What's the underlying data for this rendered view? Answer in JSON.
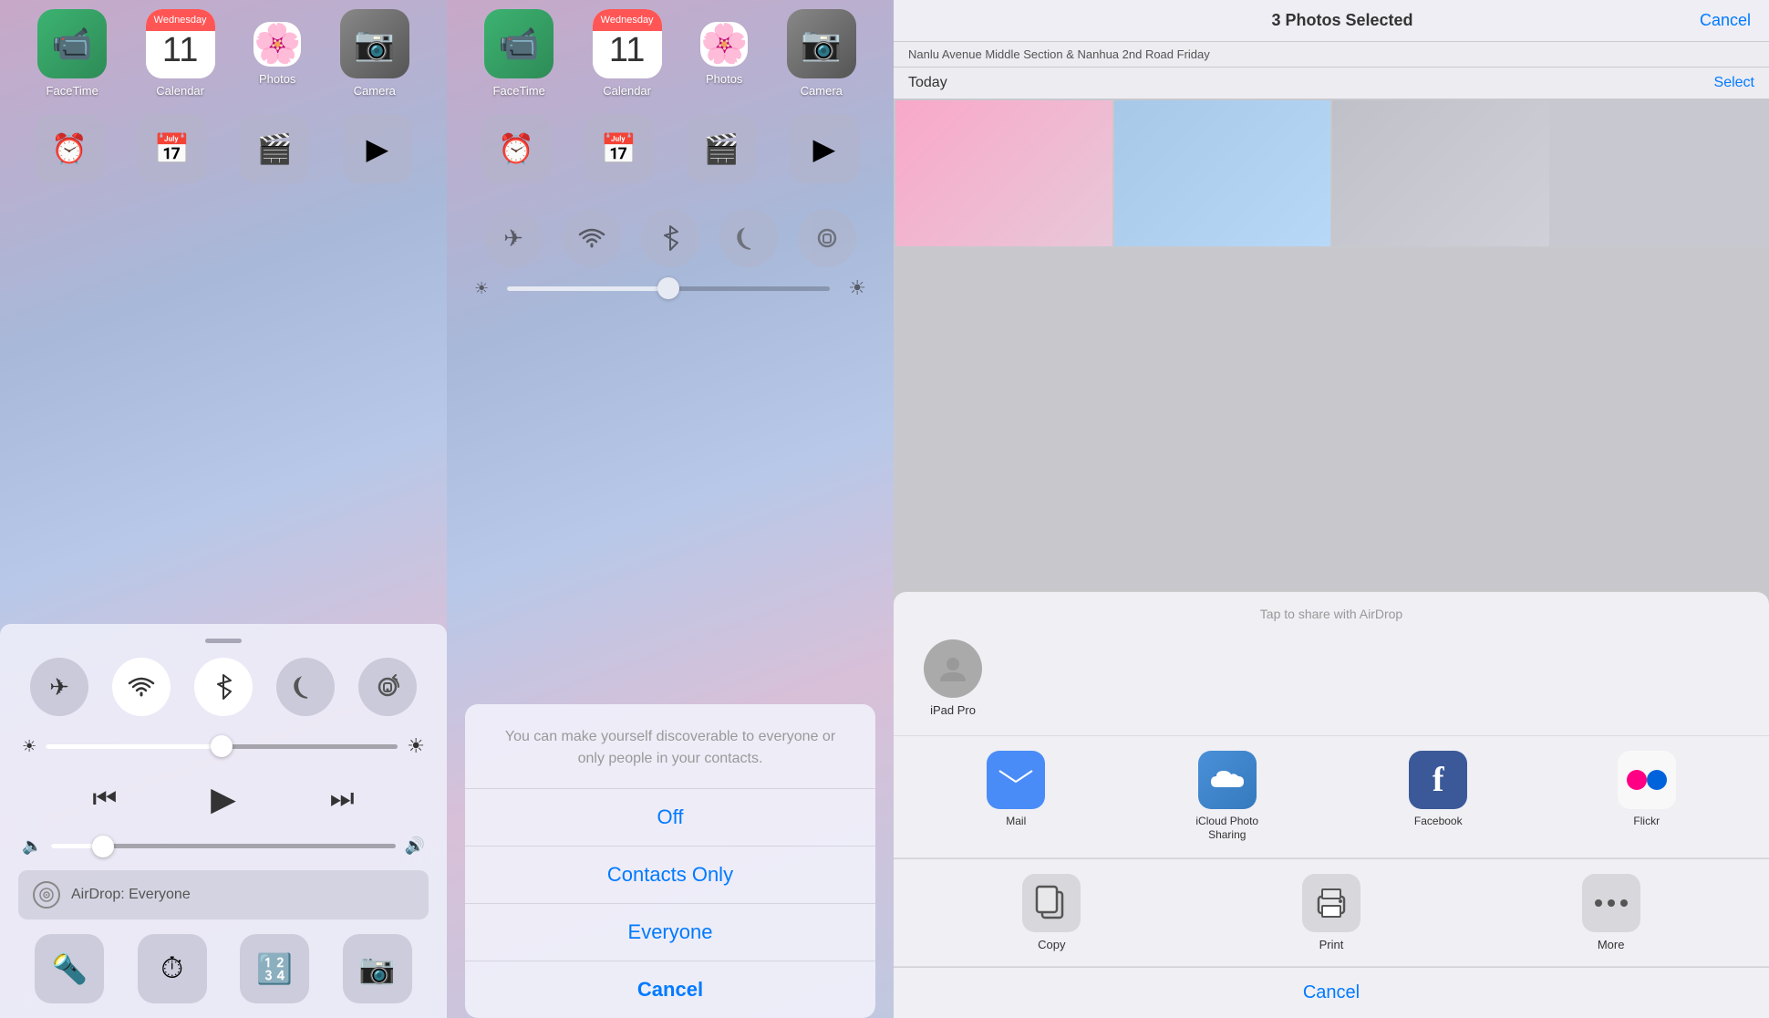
{
  "panel1": {
    "apps": [
      {
        "name": "FaceTime",
        "icon": "facetime"
      },
      {
        "name": "Calendar",
        "icon": "calendar",
        "day": "11",
        "weekday": "Wednesday"
      },
      {
        "name": "Photos",
        "icon": "photos"
      },
      {
        "name": "Camera",
        "icon": "camera"
      }
    ],
    "controlCenter": {
      "toggles": [
        {
          "name": "Airplane Mode",
          "icon": "✈",
          "active": false
        },
        {
          "name": "Wi-Fi",
          "icon": "wifi",
          "active": true
        },
        {
          "name": "Bluetooth",
          "icon": "bluetooth",
          "active": true
        },
        {
          "name": "Do Not Disturb",
          "icon": "moon",
          "active": false
        },
        {
          "name": "Rotation Lock",
          "icon": "lock",
          "active": false
        }
      ],
      "brightness": 50,
      "volume": 15,
      "airdropLabel": "AirDrop: Everyone",
      "tools": [
        "flashlight",
        "clock",
        "calculator",
        "camera"
      ]
    }
  },
  "panel2": {
    "apps": [
      {
        "name": "FaceTime",
        "icon": "facetime"
      },
      {
        "name": "Calendar",
        "icon": "calendar",
        "day": "11",
        "weekday": "Wednesday"
      },
      {
        "name": "Photos",
        "icon": "photos"
      },
      {
        "name": "Camera",
        "icon": "camera"
      }
    ],
    "airdropSheet": {
      "description": "You can make yourself discoverable to everyone or only people in your contacts.",
      "options": [
        "Off",
        "Contacts Only",
        "Everyone"
      ],
      "cancelLabel": "Cancel"
    }
  },
  "panel3": {
    "header": {
      "title": "3 Photos Selected",
      "cancelLabel": "Cancel",
      "sectionLabel": "Today",
      "selectLabel": "Select"
    },
    "locationText": "Nanlu Avenue Middle Section & Nanhua 2nd Road  Friday",
    "shareSheet": {
      "airdropLabel": "Tap to share with AirDrop",
      "device": "iPad Pro",
      "apps": [
        {
          "name": "Mail",
          "icon": "mail"
        },
        {
          "name": "iCloud Photo Sharing",
          "icon": "icloud"
        },
        {
          "name": "Facebook",
          "icon": "facebook"
        },
        {
          "name": "Flickr",
          "icon": "flickr"
        }
      ],
      "actions": [
        {
          "name": "Copy",
          "icon": "copy"
        },
        {
          "name": "Print",
          "icon": "print"
        },
        {
          "name": "More",
          "icon": "more"
        }
      ],
      "cancelLabel": "Cancel"
    }
  }
}
